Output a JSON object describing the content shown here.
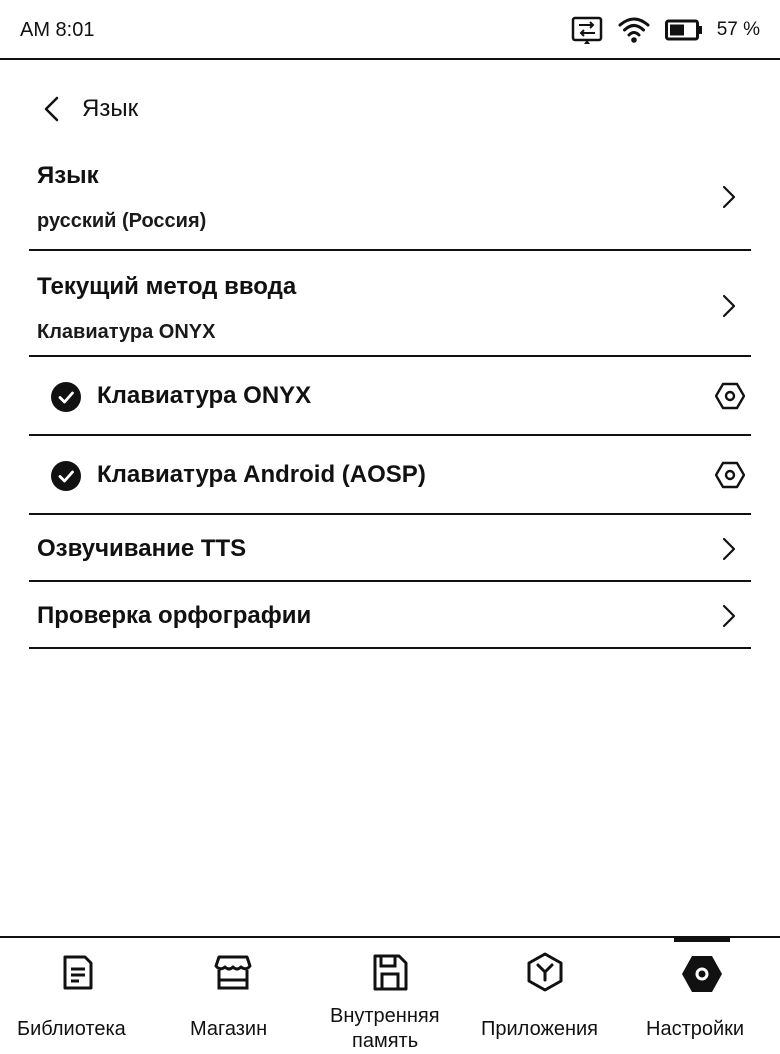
{
  "status_bar": {
    "time": "AM  8:01",
    "battery": "57 %"
  },
  "header": {
    "title": "Язык"
  },
  "settings": {
    "language": {
      "title": "Язык",
      "value": "русский (Россия)"
    },
    "input_method": {
      "title": "Текущий метод ввода",
      "value": "Клавиатура ONYX"
    },
    "keyboards": [
      {
        "label": "Клавиатура ONYX",
        "checked": true
      },
      {
        "label": "Клавиатура Android (AOSP)",
        "checked": true
      }
    ],
    "tts": {
      "title": "Озвучивание TTS"
    },
    "spellcheck": {
      "title": "Проверка орфографии"
    }
  },
  "bottom_nav": {
    "items": [
      {
        "label": "Библиотека",
        "icon": "library-icon"
      },
      {
        "label": "Магазин",
        "icon": "store-icon"
      },
      {
        "label_line1": "Внутренняя",
        "label_line2": "память",
        "icon": "storage-icon"
      },
      {
        "label": "Приложения",
        "icon": "apps-icon"
      },
      {
        "label": "Настройки",
        "icon": "settings-icon",
        "active": true
      }
    ]
  }
}
